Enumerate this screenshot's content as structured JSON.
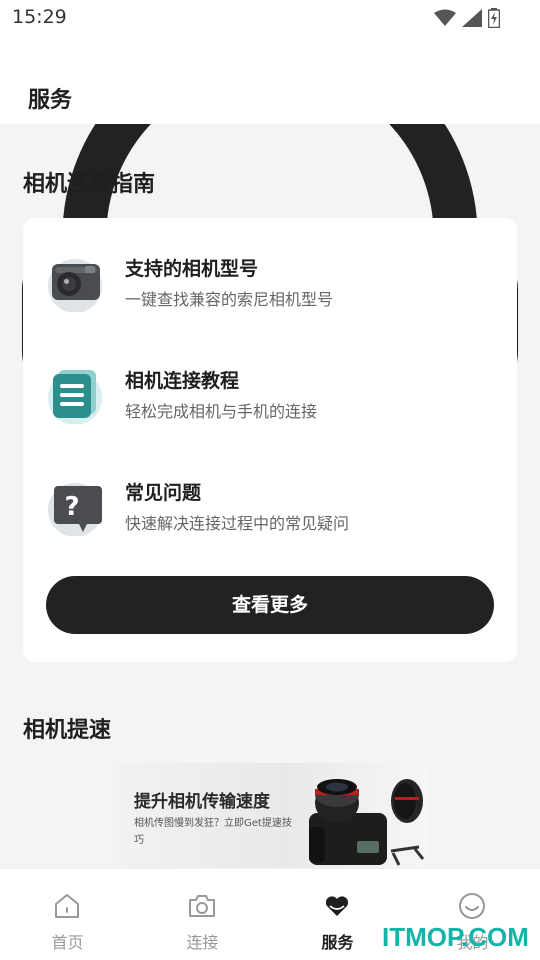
{
  "status_bar": {
    "time": "15:29"
  },
  "header": {
    "title": "服务"
  },
  "guide": {
    "title": "相机连接指南",
    "items": [
      {
        "title": "支持的相机型号",
        "desc": "一键查找兼容的索尼相机型号",
        "icon": "camera-icon"
      },
      {
        "title": "相机连接教程",
        "desc": "轻松完成相机与手机的连接",
        "icon": "document-icon"
      },
      {
        "title": "常见问题",
        "desc": "快速解决连接过程中的常见疑问",
        "icon": "question-icon"
      }
    ],
    "more_button": "查看更多"
  },
  "speedup": {
    "title": "相机提速",
    "banner": {
      "title": "提升相机传输速度",
      "subtitle": "相机传图慢到发狂？立即Get提速技巧"
    }
  },
  "tabs": [
    {
      "label": "首页",
      "icon": "home-icon",
      "active": false
    },
    {
      "label": "连接",
      "icon": "camera-icon",
      "active": false
    },
    {
      "label": "服务",
      "icon": "heart-icon",
      "active": true
    },
    {
      "label": "我的",
      "icon": "smile-icon",
      "active": false
    }
  ],
  "watermark": "ITMOP.COM",
  "colors": {
    "accent": "#222222",
    "watermark": "#12b5a7",
    "background": "#f4f4f4"
  }
}
